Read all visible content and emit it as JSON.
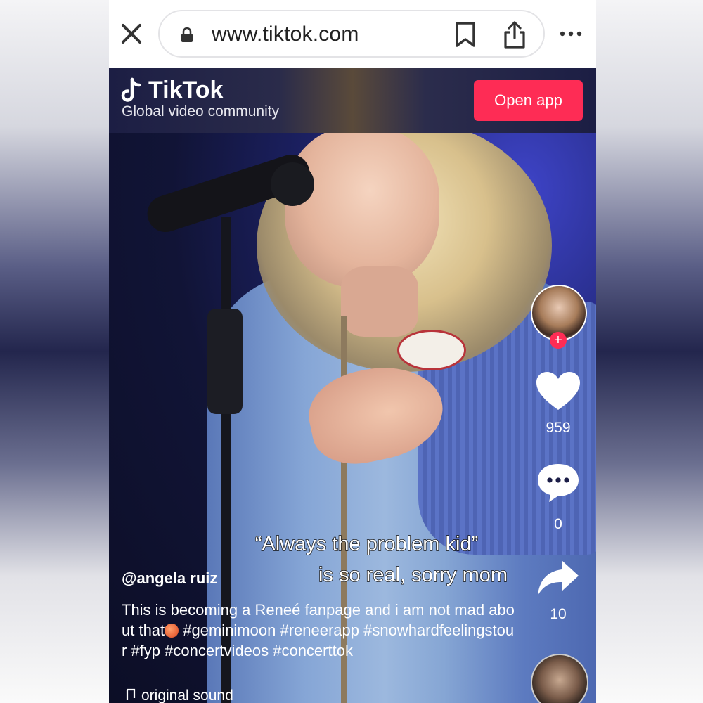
{
  "browser": {
    "url": "www.tiktok.com"
  },
  "header": {
    "brand": "TikTok",
    "subtitle": "Global video community",
    "open_app_label": "Open app"
  },
  "video": {
    "caption_line1": "“Always the problem kid”",
    "caption_line2": "is so real, sorry mom",
    "username": "@angela ruiz",
    "description_part1": "This is becoming a Reneé fanpage and i am not mad about that",
    "description_part2": " #geminimoon #reneerapp #snowhardfeelingstour #fyp #concertvideos #concerttok",
    "sound_label": "original sound"
  },
  "rail": {
    "like_count": "959",
    "comment_count": "0",
    "share_count": "10",
    "follow_label": "+"
  },
  "colors": {
    "accent": "#fe2c55",
    "browser_bg": "#ffffff"
  },
  "icons": [
    "close-icon",
    "lock-icon",
    "bookmark-icon",
    "share-icon",
    "more-icon",
    "tiktok-note-icon",
    "heart-icon",
    "comment-icon",
    "share-arrow-icon",
    "music-note-icon",
    "peach-emoji-icon"
  ]
}
